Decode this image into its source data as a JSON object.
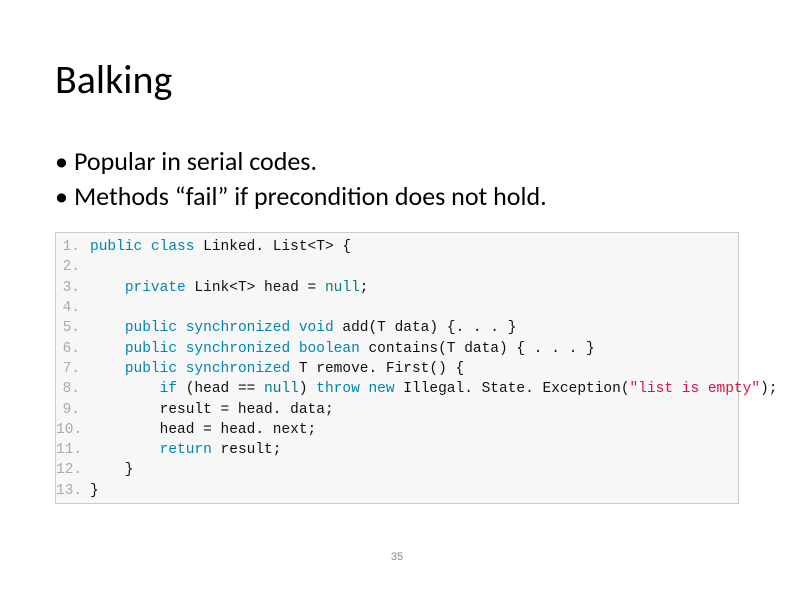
{
  "title": "Balking",
  "bullets": [
    "Popular in serial codes.",
    "Methods “fail” if precondition does not hold."
  ],
  "code": {
    "lines": [
      [
        [
          "key",
          "public"
        ],
        [
          "pl",
          " "
        ],
        [
          "key",
          "class"
        ],
        [
          "pl",
          " Linked. List<T> {"
        ]
      ],
      [],
      [
        [
          "pl",
          "    "
        ],
        [
          "key",
          "private"
        ],
        [
          "pl",
          " Link<T> head = "
        ],
        [
          "lit",
          "null"
        ],
        [
          "pl",
          ";"
        ]
      ],
      [],
      [
        [
          "pl",
          "    "
        ],
        [
          "key",
          "public"
        ],
        [
          "pl",
          " "
        ],
        [
          "key",
          "synchronized"
        ],
        [
          "pl",
          " "
        ],
        [
          "key",
          "void"
        ],
        [
          "pl",
          " add(T data) {. . . }"
        ]
      ],
      [
        [
          "pl",
          "    "
        ],
        [
          "key",
          "public"
        ],
        [
          "pl",
          " "
        ],
        [
          "key",
          "synchronized"
        ],
        [
          "pl",
          " "
        ],
        [
          "key",
          "boolean"
        ],
        [
          "pl",
          " contains(T data) { . . . }"
        ]
      ],
      [
        [
          "pl",
          "    "
        ],
        [
          "key",
          "public"
        ],
        [
          "pl",
          " "
        ],
        [
          "key",
          "synchronized"
        ],
        [
          "pl",
          " T remove. First() {"
        ]
      ],
      [
        [
          "pl",
          "        "
        ],
        [
          "key",
          "if"
        ],
        [
          "pl",
          " (head == "
        ],
        [
          "lit",
          "null"
        ],
        [
          "pl",
          ") "
        ],
        [
          "key",
          "throw"
        ],
        [
          "pl",
          " "
        ],
        [
          "key",
          "new"
        ],
        [
          "pl",
          " Illegal. State. Exception("
        ],
        [
          "str",
          "\"list is empty\""
        ],
        [
          "pl",
          ");"
        ]
      ],
      [
        [
          "pl",
          "        result = head. data;"
        ]
      ],
      [
        [
          "pl",
          "        head = head. next;"
        ]
      ],
      [
        [
          "pl",
          "        "
        ],
        [
          "key",
          "return"
        ],
        [
          "pl",
          " result;"
        ]
      ],
      [
        [
          "pl",
          "    }"
        ]
      ],
      [
        [
          "pl",
          "}"
        ]
      ]
    ]
  },
  "page_number": "35"
}
